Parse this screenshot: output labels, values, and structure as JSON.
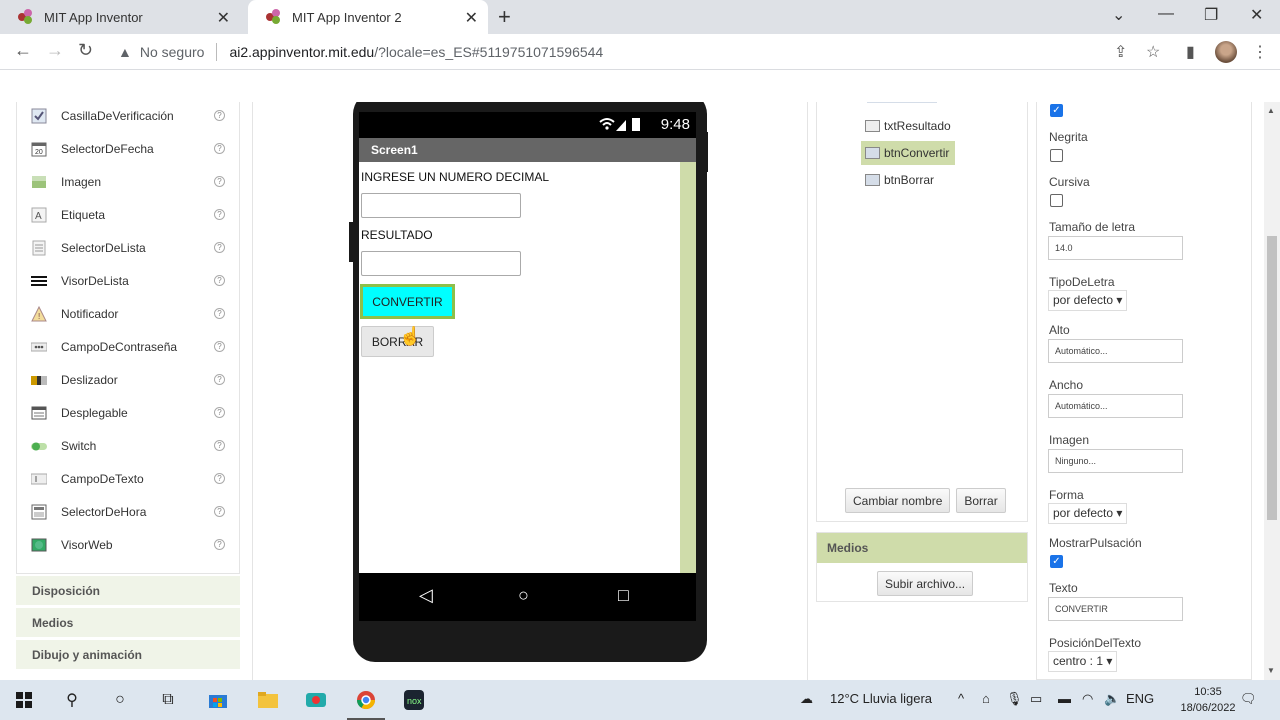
{
  "browser": {
    "tabs": [
      {
        "title": "MIT App Inventor",
        "active": false
      },
      {
        "title": "MIT App Inventor 2",
        "active": true
      }
    ],
    "security_label": "No seguro",
    "url_host": "ai2.appinventor.mit.edu",
    "url_rest": "/?locale=es_ES#5119751071596544"
  },
  "palette": {
    "items": [
      {
        "label": "CasillaDeVerificación",
        "icon": "checkbox-icon"
      },
      {
        "label": "SelectorDeFecha",
        "icon": "calendar-icon"
      },
      {
        "label": "Imagen",
        "icon": "image-icon"
      },
      {
        "label": "Etiqueta",
        "icon": "label-icon"
      },
      {
        "label": "SelectorDeLista",
        "icon": "listpicker-icon"
      },
      {
        "label": "VisorDeLista",
        "icon": "listview-icon"
      },
      {
        "label": "Notificador",
        "icon": "warning-icon"
      },
      {
        "label": "CampoDeContraseña",
        "icon": "password-icon"
      },
      {
        "label": "Deslizador",
        "icon": "slider-icon"
      },
      {
        "label": "Desplegable",
        "icon": "spinner-icon"
      },
      {
        "label": "Switch",
        "icon": "switch-icon"
      },
      {
        "label": "CampoDeTexto",
        "icon": "textbox-icon"
      },
      {
        "label": "SelectorDeHora",
        "icon": "timepicker-icon"
      },
      {
        "label": "VisorWeb",
        "icon": "webviewer-icon"
      }
    ],
    "help_glyph": "?",
    "drawers": [
      "Disposición",
      "Medios",
      "Dibujo y animación"
    ]
  },
  "phone": {
    "time": "9:48",
    "screen_title": "Screen1",
    "label1": "INGRESE UN NUMERO DECIMAL",
    "label2": "RESULTADO",
    "btn_convert": "CONVERTIR",
    "btn_borrar": "BORRAR",
    "btn_convert_color": "#00ffff"
  },
  "components": {
    "items": [
      {
        "label": "txtResultado",
        "selected": false
      },
      {
        "label": "btnConvertir",
        "selected": true
      },
      {
        "label": "btnBorrar",
        "selected": false
      }
    ],
    "rename_button": "Cambiar nombre",
    "delete_button": "Borrar"
  },
  "media": {
    "header": "Medios",
    "upload_button": "Subir archivo..."
  },
  "properties": {
    "bold_label": "Negrita",
    "italic_label": "Cursiva",
    "fontsize_label": "Tamaño de letra",
    "fontsize_value": "14.0",
    "fonttype_label": "TipoDeLetra",
    "fonttype_value": "por defecto",
    "height_label": "Alto",
    "height_value": "Automático...",
    "width_label": "Ancho",
    "width_value": "Automático...",
    "image_label": "Imagen",
    "image_value": "Ninguno...",
    "shape_label": "Forma",
    "shape_value": "por defecto",
    "showfeedback_label": "MostrarPulsación",
    "text_label": "Texto",
    "text_value": "CONVERTIR",
    "textalign_label": "PosiciónDelTexto",
    "textalign_value": "centro : 1"
  },
  "taskbar": {
    "weather": "12°C  Lluvia ligera",
    "lang": "ENG",
    "time": "10:35",
    "date": "18/06/2022"
  }
}
